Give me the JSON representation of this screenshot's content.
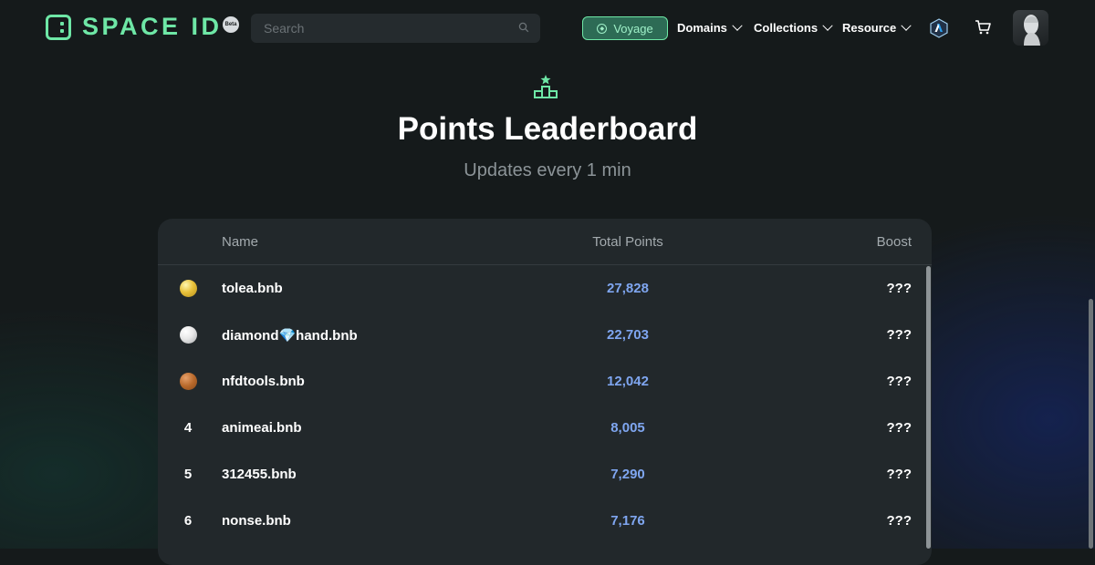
{
  "brand": {
    "name": "SPACE ID",
    "beta": "Beta"
  },
  "search": {
    "placeholder": "Search"
  },
  "nav": {
    "voyage": "Voyage",
    "items": [
      "Domains",
      "Collections",
      "Resource"
    ]
  },
  "hero": {
    "title": "Points Leaderboard",
    "subtitle": "Updates every 1 min"
  },
  "table": {
    "columns": {
      "name": "Name",
      "points": "Total Points",
      "boost": "Boost"
    },
    "rows": [
      {
        "rank": "1",
        "medal": "gold",
        "medal_color": "#e8c13a",
        "name": "tolea.bnb",
        "points": "27,828",
        "boost": "???"
      },
      {
        "rank": "2",
        "medal": "silver",
        "medal_color": "#e8e8e8",
        "name": "diamond💎hand.bnb",
        "points": "22,703",
        "boost": "???"
      },
      {
        "rank": "3",
        "medal": "bronze",
        "medal_color": "#b8692b",
        "name": "nfdtools.bnb",
        "points": "12,042",
        "boost": "???"
      },
      {
        "rank": "4",
        "name": "animeai.bnb",
        "points": "8,005",
        "boost": "???"
      },
      {
        "rank": "5",
        "name": "312455.bnb",
        "points": "7,290",
        "boost": "???"
      },
      {
        "rank": "6",
        "name": "nonse.bnb",
        "points": "7,176",
        "boost": "???"
      }
    ]
  },
  "colors": {
    "accent": "#6ee7a6",
    "points": "#7fa6f0",
    "background": "#151a1b",
    "panel": "#22282b"
  },
  "icons": [
    "search-icon",
    "voyage-icon",
    "chevron-down-icon",
    "arbitrum-icon",
    "cart-icon",
    "avatar",
    "podium-icon",
    "gold-medal-icon",
    "silver-medal-icon",
    "bronze-medal-icon"
  ]
}
